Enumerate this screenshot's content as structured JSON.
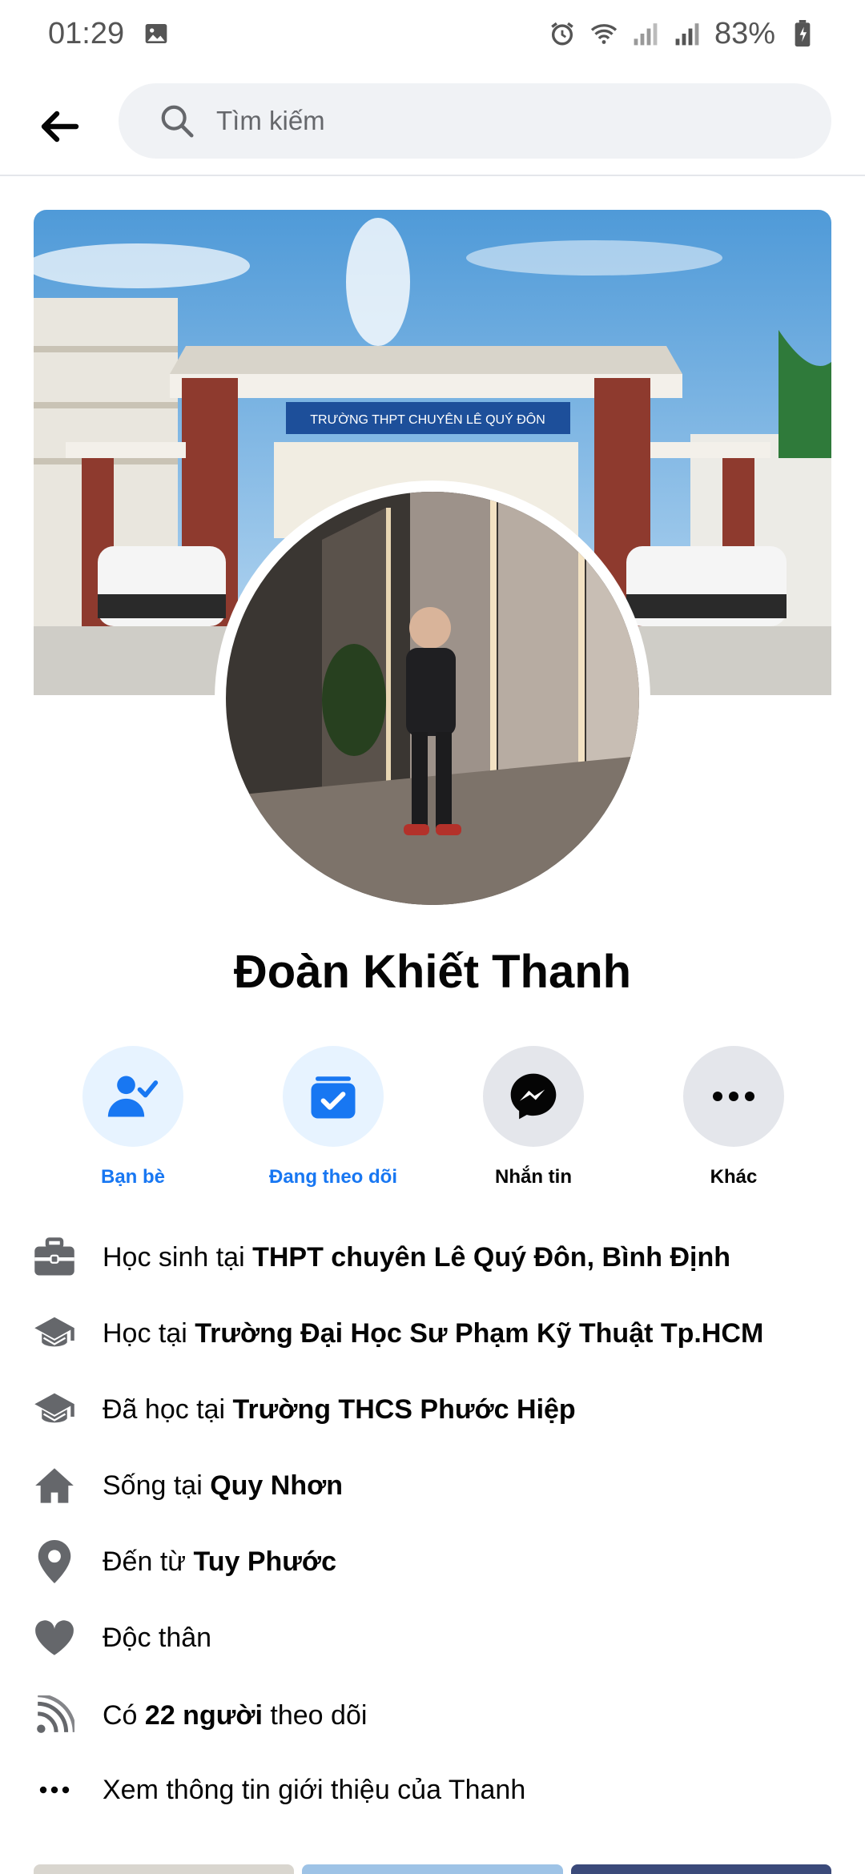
{
  "status_bar": {
    "time": "01:29",
    "battery": "83%"
  },
  "header": {
    "search_placeholder": "Tìm kiếm"
  },
  "profile": {
    "name": "Đoàn Khiết Thanh",
    "cover_banner_text": "TRƯỜNG THPT CHUYÊN LÊ QUÝ ĐÔN"
  },
  "actions": [
    {
      "label": "Bạn bè",
      "icon": "friends-check-icon",
      "color": "#1877f2"
    },
    {
      "label": "Đang theo dõi",
      "icon": "following-check-icon",
      "color": "#1877f2"
    },
    {
      "label": "Nhắn tin",
      "icon": "messenger-icon",
      "color": "#050505"
    },
    {
      "label": "Khác",
      "icon": "more-dots-icon",
      "color": "#050505"
    }
  ],
  "info": [
    {
      "prefix": "Học sinh tại ",
      "bold": "THPT chuyên Lê Quý Đôn, Bình Định",
      "suffix": "",
      "icon": "briefcase-icon"
    },
    {
      "prefix": "Học tại ",
      "bold": "Trường Đại Học Sư Phạm Kỹ Thuật Tp.HCM",
      "suffix": "",
      "icon": "graduation-cap-icon"
    },
    {
      "prefix": "Đã học tại ",
      "bold": "Trường THCS Phước Hiệp",
      "suffix": "",
      "icon": "graduation-cap-icon"
    },
    {
      "prefix": "Sống tại ",
      "bold": "Quy Nhơn",
      "suffix": "",
      "icon": "home-icon"
    },
    {
      "prefix": "Đến từ ",
      "bold": "Tuy Phước",
      "suffix": "",
      "icon": "location-pin-icon"
    },
    {
      "prefix": "Độc thân",
      "bold": "",
      "suffix": "",
      "icon": "heart-icon"
    },
    {
      "prefix": "Có ",
      "bold": "22 người",
      "suffix": " theo dõi",
      "icon": "rss-feed-icon"
    },
    {
      "prefix": "Xem thông tin giới thiệu của Thanh",
      "bold": "",
      "suffix": "",
      "icon": "more-dots-icon"
    }
  ],
  "colors": {
    "accent": "#1877f2",
    "accent_light": "#e7f3ff",
    "gray_button": "#e4e6eb",
    "icon_gray": "#65676b"
  }
}
